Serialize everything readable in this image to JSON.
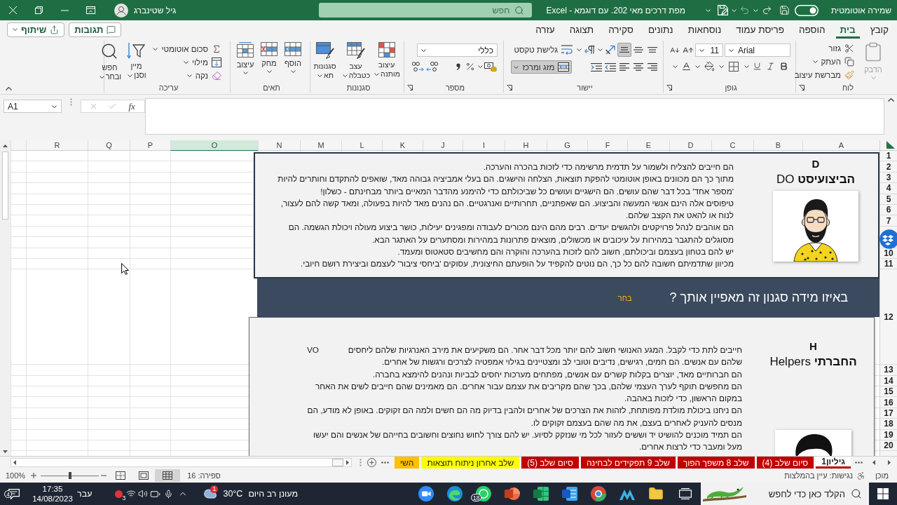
{
  "title_bar": {
    "autosave": {
      "label": "שמירה אוטומטית"
    },
    "document_title": "מפת דרכים מאי 202. עם דוגמא - Excel",
    "search": {
      "placeholder": "חפש"
    },
    "user_name": "גיל שטינברג"
  },
  "ribbon_tabs": [
    {
      "label": "קובץ",
      "selected": false
    },
    {
      "label": "בית",
      "selected": true
    },
    {
      "label": "הוספה",
      "selected": false
    },
    {
      "label": "פריסת עמוד",
      "selected": false
    },
    {
      "label": "נוסחאות",
      "selected": false
    },
    {
      "label": "נתונים",
      "selected": false
    },
    {
      "label": "סקירה",
      "selected": false
    },
    {
      "label": "תצוגה",
      "selected": false
    },
    {
      "label": "עזרה",
      "selected": false
    }
  ],
  "comments_button": "תגובות",
  "share_button": "שיתוף",
  "ribbon": {
    "clipboard": {
      "label": "לוח",
      "paste": {
        "label": "הדבק",
        "disabled": true
      },
      "cut": "גזור",
      "copy": "העתק",
      "format_painter": "מברשת עיצוב"
    },
    "font": {
      "label": "גופן",
      "font_name": "Arial",
      "font_size": "11"
    },
    "alignment": {
      "label": "יישור",
      "vertical": [
        {
          "selected": false
        },
        {
          "selected": false
        },
        {
          "selected": true
        }
      ],
      "wrap_text": {
        "label": "גלישת טקסט",
        "on": false
      },
      "merge_center": {
        "label": "מזג ומרכז",
        "on": true
      }
    },
    "number": {
      "label": "מספר",
      "format": "כללי"
    },
    "styles": {
      "label": "סגנונות",
      "conditional_formatting": "עיצוב מותנה",
      "format_as_table": "עצב כטבלה",
      "cell_styles": "סגנונות תא"
    },
    "cells": {
      "label": "תאים",
      "insert": "הוסף",
      "delete": "מחק",
      "format": "עיצוב"
    },
    "editing": {
      "label": "עריכה",
      "autosum": "סכום אוטומטי",
      "fill": "מילוי",
      "clear": "נקה",
      "sort_filter": "מיין וסנן",
      "find_select": "חפש ובחר"
    }
  },
  "formula_bar": {
    "name_box": "A1",
    "function_button": "fx"
  },
  "columns": [
    {
      "label": "A",
      "selected": false
    },
    {
      "label": "B",
      "selected": false
    },
    {
      "label": "C",
      "selected": false
    },
    {
      "label": "D",
      "selected": false
    },
    {
      "label": "E",
      "selected": false
    },
    {
      "label": "F",
      "selected": false
    },
    {
      "label": "G",
      "selected": false
    },
    {
      "label": "H",
      "selected": false
    },
    {
      "label": "I",
      "selected": false
    },
    {
      "label": "J",
      "selected": false
    },
    {
      "label": "K",
      "selected": false
    },
    {
      "label": "L",
      "selected": false
    },
    {
      "label": "M",
      "selected": false
    },
    {
      "label": "N",
      "selected": false
    },
    {
      "label": "O",
      "selected": true
    },
    {
      "label": "P",
      "selected": false
    },
    {
      "label": "Q",
      "selected": false
    },
    {
      "label": "R",
      "selected": false
    }
  ],
  "rows_upper": [
    "1",
    "2",
    "3",
    "4",
    "5",
    "6",
    "7"
  ],
  "rows_lower": [
    "10",
    "11",
    "12",
    "13",
    "14",
    "15",
    "16",
    "17",
    "18",
    "19",
    "20"
  ],
  "sheet_objects": [
    {
      "kind": "card",
      "letter": "D",
      "title": "**הביצועיסט** DO",
      "paragraphs": [
        "הם חייבים להצליח ולשמור על תדמית מרשימה כדי לזכות בהכרה והערכה.",
        "מתוך כך הם מכוונים באופן אוטומטי להפקת תוצאות, הצלחה והישגים. הם בעלי אמביציה גבוהה מאד, שואפים להתקדם וחותרים להיות 'מספר אחד' בכל דבר שהם עושים. הם הישגיים ועושים כל שביכולתם כדי להימנע מהדבר המאיים ביותר מבחינתם - כשלון!",
        "טיפוסים אלה הינם אנשי המעשה והביצוע. הם שאפתניים, תחרותיים ואנרגטיים. הם נהנים מאד להיות בפעולה, ומאד קשה להם לעצור, לנוח או להאט את הקצב שלהם.",
        "הם אוהבים לנהל פרויקטים ולהגשים יעדים. רבים מהם הינם מכורים לעבודה ומפגינים יעילות, כושר ביצוע מעולה ויכולת הגשמה. הם מסוגלים להתגבר במהירות על עיכובים או מכשולים, מוצאים פתרונות במהירות ומסתערים על האתגר הבא.",
        "יש להם בטחון בעצמם וביכולתם, חשוב להם לזכות בהערכה והוקרה והם מחשיבים סטאטוס ומעמד.",
        "מכיוון שתדמיתם חשובה להם כל כך, הם נוטים להקפיד על הופעתם החיצונית, עסוקים 'ביחסי ציבור' לעצמם וביצירת רושם חיובי."
      ]
    },
    {
      "kind": "banner",
      "question": "באיזו מידה סגנון זה מאפיין אותך ?",
      "prompt": "בחר"
    },
    {
      "kind": "card",
      "letter": "H",
      "title": "**החברתי** Helpers",
      "side_note": "VO",
      "paragraphs": [
        "חייבים לתת כדי לקבל. המגע האנושי חשוב להם יותר מכל דבר אחר. הם משקיעים את מירב האנרגיות שלהם ליחסים שלהם עם אנשים. הם חמים, רגישים, נדיבים וטובי לב ומצטיינים בגילוי אמפטיה לצרכים ורגשות של אחרים.",
        "הם חברותיים מאד, יוצרים בקלות קשרים עם אנשים, מפתחים מערכות יחסים לבביות ונהנים להימצא בחברה.",
        "הם מחפשים תוקף לערך העצמי שלהם, בכך שהם מקריבים את עצמם עבור אחרים. הם מאמינים שהם חייבים לשים את האחר במקום הראשון, כדי לזכות באהבה.",
        "הם ניחנו ביכולת מולדת מפותחת, לזהות את הצרכים של אחרים ולהבין בדיוק מה הם חשים ולמה הם זקוקים. באופן לא מודע, הם מנסים להעניק לאחרים בעצם, את מה שהם בעצמם זקוקים לו.",
        "הם תמיד מוכנים להושיט יד וששים לעזור לכל מי שנזקק לסיוע. יש להם צורך לחוש נחוצים וחשובים בחייהם של אנשים והם יעשו מעל ומעבר כדי לרצות אחרים."
      ]
    }
  ],
  "sheet_tabs": [
    {
      "label": "גיליון1",
      "color": "#c00000",
      "selected": true
    },
    {
      "label": "סיום שלב (4)",
      "color": "#c00000",
      "selected": false
    },
    {
      "label": "שלב 8 משפך הפוך",
      "color": "#c00000",
      "selected": false
    },
    {
      "label": "שלב 9 תפקידים לבחינה",
      "color": "#c00000",
      "selected": false
    },
    {
      "label": "סיום שלב (5)",
      "color": "#c00000",
      "selected": false
    },
    {
      "label": "שלב אחרון ניתוח תוצאות",
      "color": "#ffff00",
      "selected": false
    },
    {
      "label": "השי",
      "color": "#ffc000",
      "selected": false
    }
  ],
  "status_bar": {
    "ready": "מוכן",
    "accessibility": "נגישות: עיין בהמלצות",
    "count": "ספירה: 16",
    "views": [
      {
        "selected": true
      },
      {
        "selected": false
      },
      {
        "selected": false
      }
    ],
    "zoom": {
      "label": "100%",
      "level": 0.5
    }
  },
  "taskbar": {
    "search": {
      "placeholder": "הקלד כאן כדי לחפש"
    },
    "chat_badge": "18",
    "weather": {
      "badge": "1",
      "temperature": "30°C",
      "condition": "מעונן רב היום"
    },
    "tray_badge": "3",
    "language": "עבר",
    "time": "17:35",
    "date": "14/08/2023",
    "notifications": "4"
  }
}
